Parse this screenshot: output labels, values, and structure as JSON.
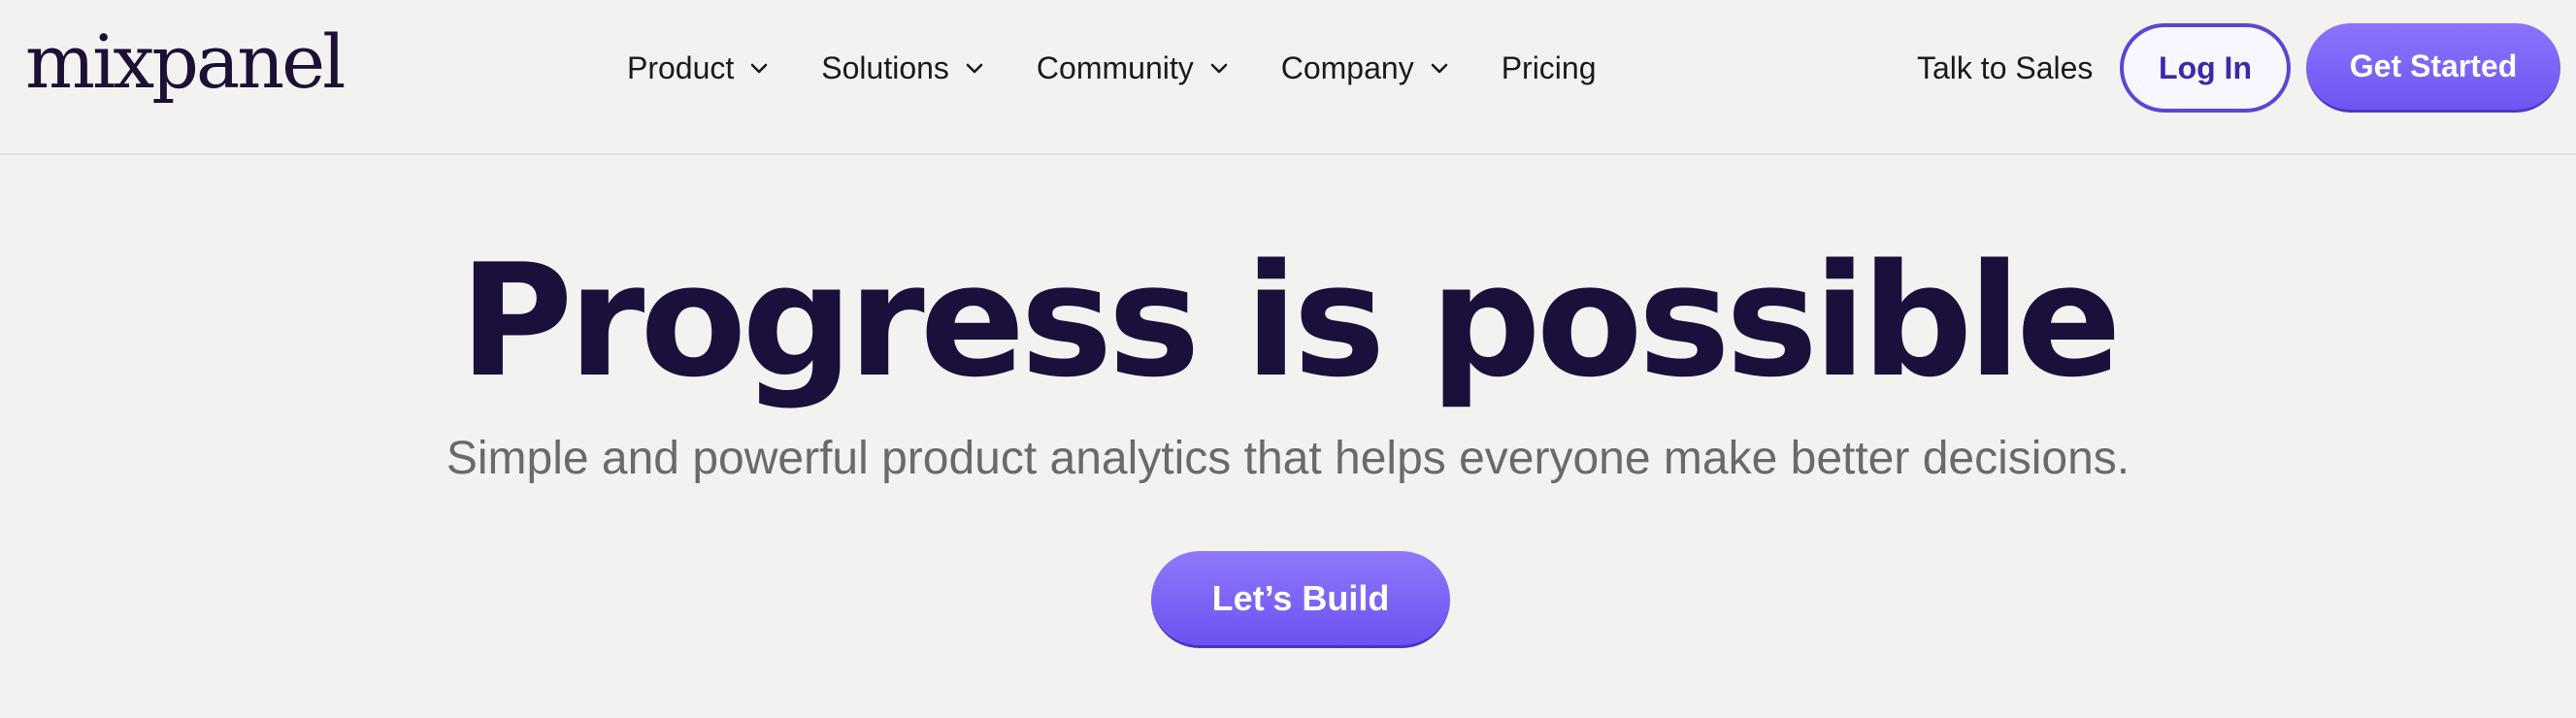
{
  "header": {
    "logo_text": "mixpanel",
    "nav": [
      {
        "label": "Product",
        "has_dropdown": true,
        "icon": "chevron-down-icon"
      },
      {
        "label": "Solutions",
        "has_dropdown": true,
        "icon": "chevron-down-icon"
      },
      {
        "label": "Community",
        "has_dropdown": true,
        "icon": "chevron-down-icon"
      },
      {
        "label": "Company",
        "has_dropdown": true,
        "icon": "chevron-down-icon"
      },
      {
        "label": "Pricing",
        "has_dropdown": false
      }
    ],
    "talk_to_sales": "Talk to Sales",
    "login_label": "Log In",
    "get_started_label": "Get Started"
  },
  "hero": {
    "title": "Progress is possible",
    "subtitle": "Simple and powerful product analytics that helps everyone make better decisions.",
    "cta_label": "Let’s Build"
  },
  "colors": {
    "background": "#f3f2f1",
    "brand_dark": "#1b0f3b",
    "accent_purple": "#7856f5",
    "login_border": "#5b45d4",
    "subtitle_gray": "#6b6a6a"
  }
}
